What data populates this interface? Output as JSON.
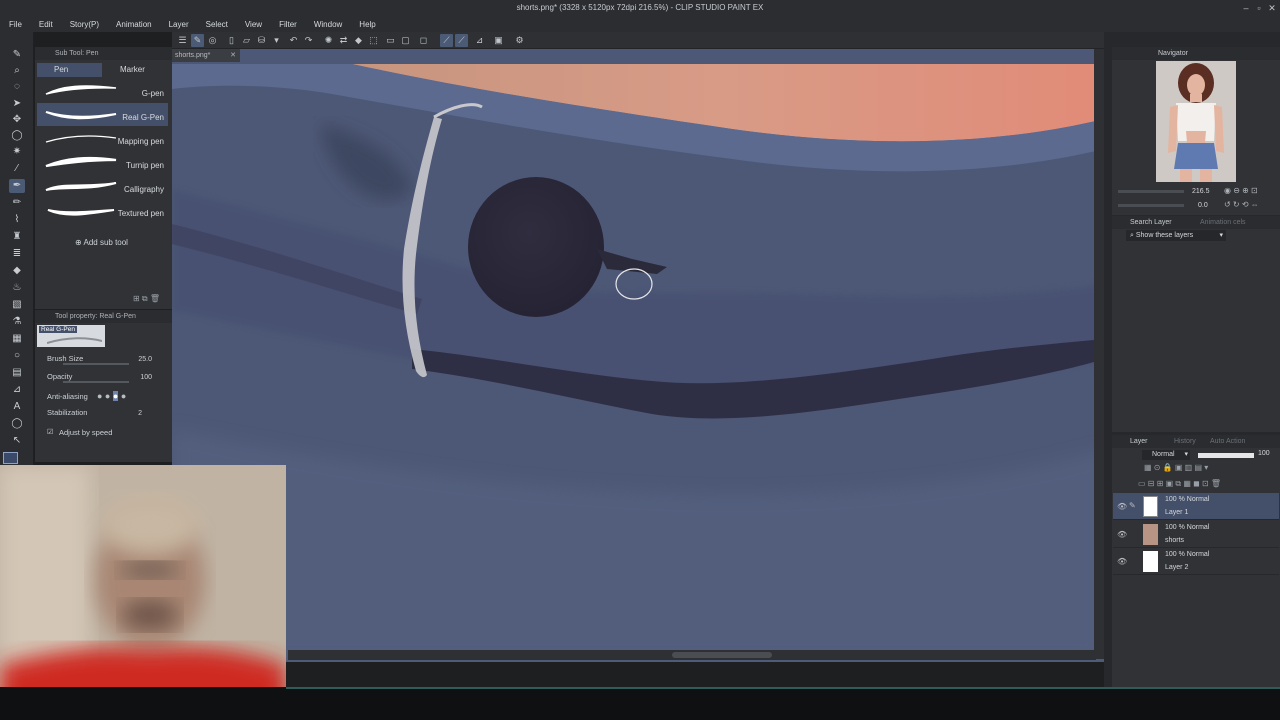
{
  "window": {
    "title": "shorts.png* (3328 x 5120px 72dpi 216.5%) - CLIP STUDIO PAINT EX"
  },
  "menu": [
    "File",
    "Edit",
    "Story(P)",
    "Animation",
    "Layer",
    "Select",
    "View",
    "Filter",
    "Window",
    "Help"
  ],
  "document_tab": "shorts.png*",
  "subtool_panel": {
    "header": "Sub Tool: Pen",
    "tabs": [
      "Pen",
      "Marker"
    ],
    "brushes": [
      "G-pen",
      "Real G-Pen",
      "Mapping pen",
      "Turnip pen",
      "Calligraphy",
      "Textured pen"
    ],
    "selected_brush": "Real G-Pen",
    "add_label": "Add sub tool"
  },
  "tool_property": {
    "header": "Tool property: Real G-Pen",
    "preview_label": "Real G-Pen",
    "brush_size_label": "Brush Size",
    "brush_size_value": "25.0",
    "opacity_label": "Opacity",
    "opacity_value": "100",
    "antialiasing_label": "Anti-aliasing",
    "stabilization_label": "Stabilization",
    "stabilization_value": "2",
    "adjust_by_speed_label": "Adjust by speed",
    "adjust_by_speed_checked": true
  },
  "navigator": {
    "tab": "Navigator",
    "zoom_value": "216.5",
    "rotate_value": "0.0"
  },
  "search_layer": {
    "tab": "Search Layer",
    "tab2": "Animation cels",
    "filter_label": "Show these layers"
  },
  "layer_panel": {
    "tab": "Layer",
    "tab2": "History",
    "tab3": "Auto Action",
    "blend_mode": "Normal",
    "opacity": "100",
    "layers": [
      {
        "mode": "100 % Normal",
        "name": "Layer 1",
        "thumb": "white-sketch"
      },
      {
        "mode": "100 % Normal",
        "name": "shorts",
        "thumb": "image"
      },
      {
        "mode": "100 % Normal",
        "name": "Layer 2",
        "thumb": "white"
      }
    ],
    "selected_layer": "Layer 1"
  },
  "colors": {
    "accent_active": "#44506a",
    "canvas_base": "#4d5876",
    "skin": "#d89b86",
    "button_dark": "#2c2a3a"
  }
}
